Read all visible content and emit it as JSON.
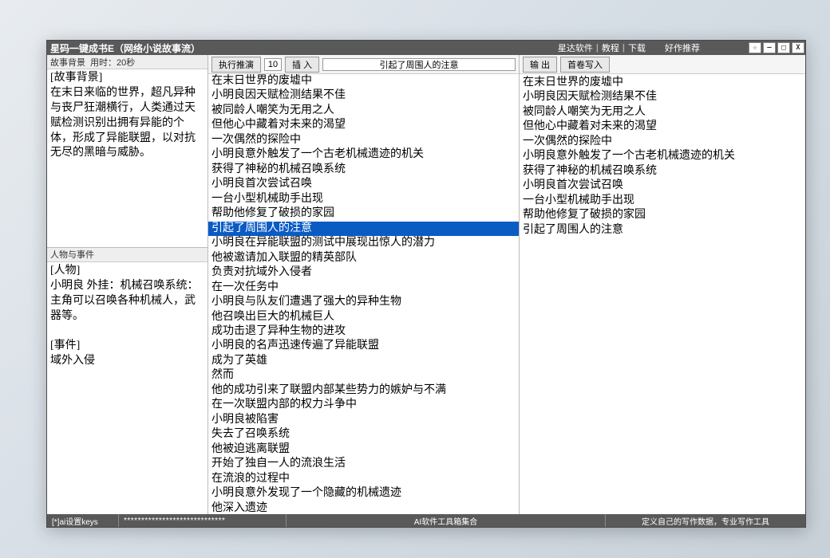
{
  "title": "星码一键成书E（网络小说故事流）",
  "title_links": [
    "星达软件",
    "教程",
    "下载"
  ],
  "title_recommend": "好作推荐",
  "win_buttons": [
    "☆",
    "–",
    "□",
    "X"
  ],
  "left": {
    "top_header_label": "故事背景",
    "top_header_time_label": "用时：",
    "top_header_time_value": "20秒",
    "story_bg": "[故事背景]\n在末日来临的世界，超凡异种与丧尸狂潮横行，人类通过天赋检测识别出拥有异能的个体，形成了异能联盟，以对抗无尽的黑暗与威胁。",
    "bottom_header": "人物与事件",
    "char_event": "[人物]\n小明良 外挂：机械召唤系统：主角可以召唤各种机械人，武器等。\n\n[事件]\n域外入侵"
  },
  "mid": {
    "btn_execute": "执行推演",
    "num_value": "10",
    "btn_insert": "插 入",
    "input_current": "引起了周围人的注意",
    "selected_index": 10,
    "lines": [
      "在末日世界的废墟中",
      "小明良因天赋检测结果不佳",
      "被同龄人嘲笑为无用之人",
      "但他心中藏着对未来的渴望",
      "一次偶然的探险中",
      "小明良意外触发了一个古老机械遗迹的机关",
      "获得了神秘的机械召唤系统",
      "小明良首次尝试召唤",
      "一台小型机械助手出现",
      "帮助他修复了破损的家园",
      "引起了周围人的注意",
      "小明良在异能联盟的测试中展现出惊人的潜力",
      "他被邀请加入联盟的精英部队",
      "负责对抗域外入侵者",
      "在一次任务中",
      "小明良与队友们遭遇了强大的异种生物",
      "他召唤出巨大的机械巨人",
      "成功击退了异种生物的进攻",
      "小明良的名声迅速传遍了异能联盟",
      "成为了英雄",
      "然而",
      "他的成功引来了联盟内部某些势力的嫉妒与不满",
      "在一次联盟内部的权力斗争中",
      "小明良被陷害",
      "失去了召唤系统",
      "他被迫逃离联盟",
      "开始了独自一人的流浪生活",
      "在流浪的过程中",
      "小明良意外发现了一个隐藏的机械遗迹",
      "他深入遗迹"
    ]
  },
  "right": {
    "btn_output": "输 出",
    "btn_write": "首卷写入",
    "content": "在末日世界的废墟中\n小明良因天赋检测结果不佳\n被同龄人嘲笑为无用之人\n但他心中藏着对未来的渴望\n一次偶然的探险中\n小明良意外触发了一个古老机械遗迹的机关\n获得了神秘的机械召唤系统\n小明良首次尝试召唤\n一台小型机械助手出现\n帮助他修复了破损的家园\n引起了周围人的注意"
  },
  "status": {
    "keys": "[*]ai设置keys",
    "masked": "*****************************",
    "center": "AI软件工具箱集合",
    "right": "定义自己的写作数据，专业写作工具"
  }
}
